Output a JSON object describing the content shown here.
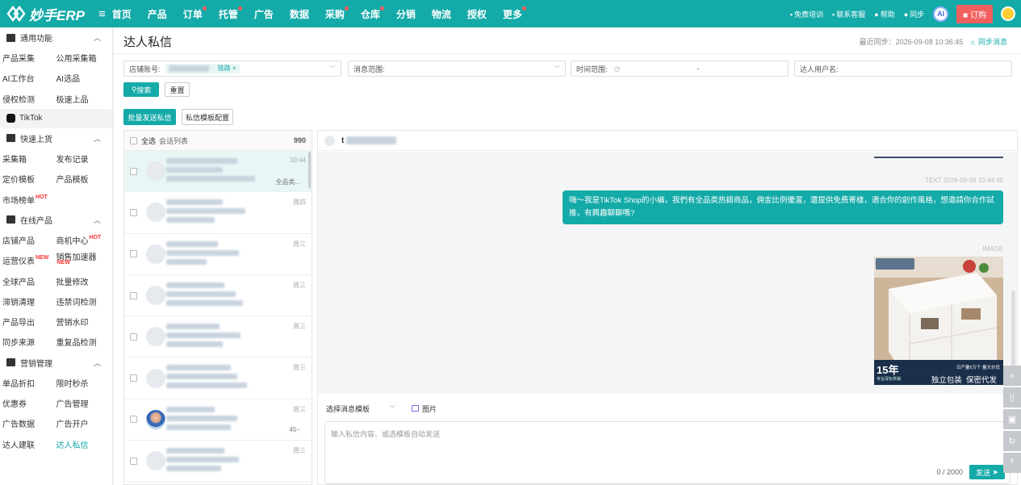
{
  "topbar": {
    "logo_text": "妙手ERP",
    "nav": [
      {
        "label": "首页",
        "dot": false
      },
      {
        "label": "产品",
        "dot": false
      },
      {
        "label": "订单",
        "dot": true
      },
      {
        "label": "托管",
        "dot": true
      },
      {
        "label": "广告",
        "dot": false
      },
      {
        "label": "数据",
        "dot": false
      },
      {
        "label": "采购",
        "dot": true
      },
      {
        "label": "仓库",
        "dot": true
      },
      {
        "label": "分销",
        "dot": false
      },
      {
        "label": "物流",
        "dot": false
      },
      {
        "label": "授权",
        "dot": false
      },
      {
        "label": "更多",
        "dot": true
      }
    ],
    "tools": {
      "training": "免费培训",
      "service": "联系客服",
      "help": "帮助",
      "sync": "同步"
    },
    "ai_label": "AI",
    "order_label": "订购"
  },
  "sidebar": {
    "sec_common": "通用功能",
    "common_rows": [
      [
        "产品采集",
        "公用采集箱"
      ],
      [
        "AI工作台",
        "AI选品"
      ],
      [
        "侵权检测",
        "极速上品"
      ]
    ],
    "tiktok": "TikTok",
    "sec_quick": "快速上货",
    "quick_rows": [
      [
        "采集箱",
        "发布记录"
      ],
      [
        "定价模板",
        "产品模板"
      ],
      [
        "市场榜单",
        ""
      ]
    ],
    "sec_online": "在线产品",
    "online_rows": [
      [
        "店铺产品",
        "商机中心"
      ],
      [
        "运营仪表",
        "销售加速器"
      ],
      [
        "全球产品",
        "批量修改"
      ],
      [
        "滞销清理",
        "违禁词检测"
      ],
      [
        "产品导出",
        "营销水印"
      ],
      [
        "同步来源",
        "重复品检测"
      ]
    ],
    "sec_marketing": "营销管理",
    "marketing_rows": [
      [
        "单品折扣",
        "限时秒杀"
      ],
      [
        "优惠券",
        "广告管理"
      ],
      [
        "广告数据",
        "广告开户"
      ],
      [
        "达人建联",
        "达人私信"
      ]
    ],
    "tag_hot": "HOT",
    "tag_new": "NEW"
  },
  "page": {
    "title": "达人私信",
    "sync_text": "最近同步：2026-09-08 10:36:45",
    "sync_link": "同步消息"
  },
  "filters": {
    "store_label": "店铺账号:",
    "store_tag_suffix": "链路",
    "msg_range": "消息范围:",
    "time_range": "时间范围:",
    "time_sep": "-",
    "creator_name": "达人用户名:"
  },
  "buttons": {
    "search": "搜索",
    "reset": "重置",
    "batch_send": "批量发送私信",
    "template_config": "私信模板配置"
  },
  "conversations": {
    "select_all": "全选",
    "list_label": "会话列表",
    "count": "990",
    "items": [
      {
        "time": "10:44",
        "snippet": "全品类...",
        "selected": true,
        "photo": false
      },
      {
        "time": "周四",
        "snippet": "",
        "selected": false,
        "photo": false
      },
      {
        "time": "周三",
        "snippet": "",
        "selected": false,
        "photo": false
      },
      {
        "time": "周三",
        "snippet": "",
        "selected": false,
        "photo": false
      },
      {
        "time": "周三",
        "snippet": "",
        "selected": false,
        "photo": false
      },
      {
        "time": "周三",
        "snippet": "",
        "selected": false,
        "photo": false
      },
      {
        "time": "周三",
        "snippet": "45~",
        "selected": false,
        "photo": true
      },
      {
        "time": "周三",
        "snippet": "",
        "selected": false,
        "photo": false
      }
    ]
  },
  "chat": {
    "header_initial": "t",
    "text_meta": "TEXT 2026-09-08 10:44:45",
    "message": "嗨～我是TikTok Shop的小编，我們有全品类热銷商品，佣金比例優渥，還提供免费寄樣，適合你的創作風格，想邀請你合作試推，有興趣聊聊嗎?",
    "image_meta": "IMAGE",
    "image_badge_year": "15年",
    "image_badge_sub": "专业深化供销",
    "image_tagline": "独立包装  保密代发",
    "image_tag_top": "日产量5万个 量大价优",
    "template_select": "选择消息模板",
    "image_btn": "图片",
    "input_placeholder": "输入私信内容、或选模板自动发送",
    "counter": "0 / 2000",
    "send": "发送"
  },
  "colors": {
    "brand": "#13aaa8",
    "order_btn": "#f25f5f"
  }
}
